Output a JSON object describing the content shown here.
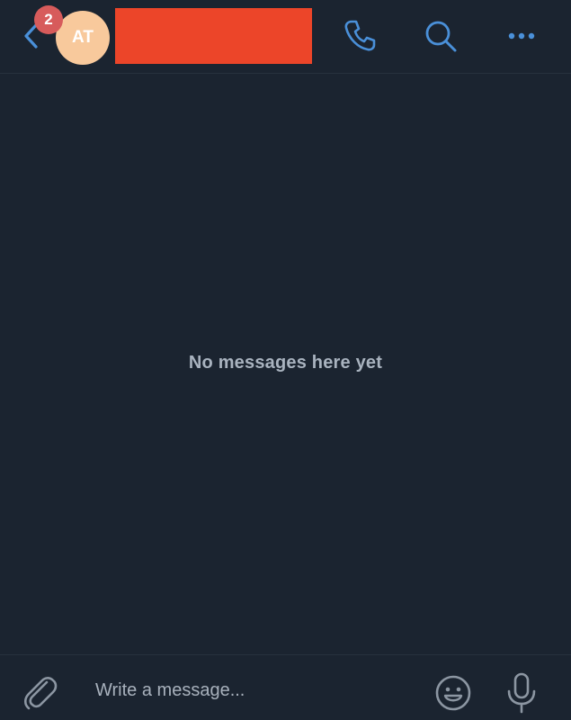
{
  "header": {
    "back_icon": "chevron-left-icon",
    "unread_count": "2",
    "avatar_initials": "AT",
    "call_icon": "phone-icon",
    "search_icon": "search-icon",
    "more_icon": "more-horizontal-icon"
  },
  "conversation": {
    "empty_text": "No messages here yet"
  },
  "composer": {
    "attach_icon": "paperclip-icon",
    "placeholder": "Write a message...",
    "emoji_icon": "smiley-icon",
    "mic_icon": "microphone-icon"
  },
  "colors": {
    "background": "#1b2430",
    "accent": "#4a90d9",
    "avatar": "#f8c99c",
    "badge": "#d75b5b",
    "redaction": "#ec4529"
  }
}
